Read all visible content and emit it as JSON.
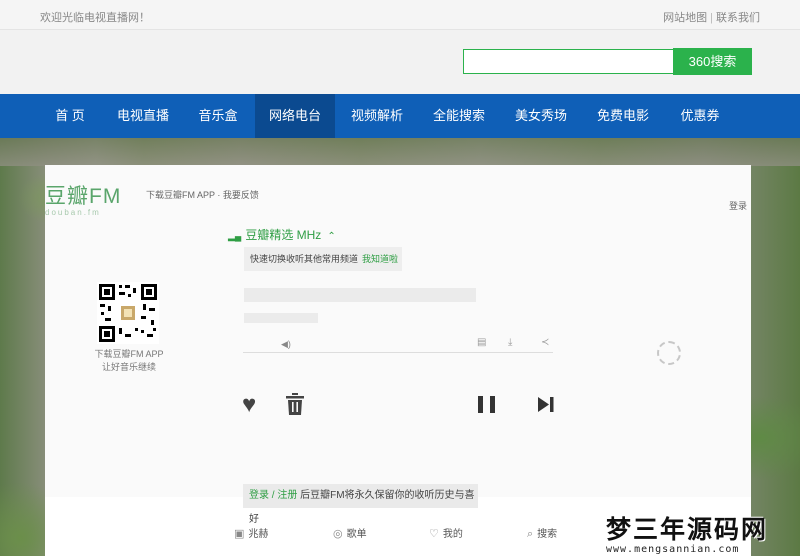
{
  "topbar": {
    "welcome": "欢迎光临电视直播网！",
    "sitemap": "网站地图",
    "separator": "|",
    "contact": "联系我们"
  },
  "search": {
    "placeholder": "",
    "button": "360搜索"
  },
  "nav": {
    "items": [
      {
        "label": "首 页"
      },
      {
        "label": "电视直播"
      },
      {
        "label": "音乐盒"
      },
      {
        "label": "网络电台"
      },
      {
        "label": "视频解析"
      },
      {
        "label": "全能搜索"
      },
      {
        "label": "美女秀场"
      },
      {
        "label": "免费电影"
      },
      {
        "label": "优惠券"
      }
    ],
    "active_index": 3
  },
  "player": {
    "logo_name": "豆瓣FM",
    "logo_sub": "douban.fm",
    "top_links": "下载豆瓣FM APP · 我要反馈",
    "login": "登录",
    "qr_text_1": "下载豆瓣FM APP",
    "qr_text_2": "让好音乐继续",
    "channel": "豆瓣精选 MHz",
    "tip_text": "快速切换收听其他常用频道",
    "tip_got": "我知道啦",
    "login_tip_login": "登录",
    "login_tip_slash": " / ",
    "login_tip_register": "注册",
    "login_tip_rest": " 后豆瓣FM将永久保留你的收听历史与喜好",
    "accent_color": "#2f9e44"
  },
  "bottom_nav": {
    "items": [
      {
        "label": "兆赫",
        "icon": "radio-icon"
      },
      {
        "label": "歌单",
        "icon": "playlist-icon"
      },
      {
        "label": "我的",
        "icon": "heart-icon"
      },
      {
        "label": "搜索",
        "icon": "search-icon"
      }
    ]
  },
  "watermark": {
    "main": "梦三年源码网",
    "sub": "www.mengsannian.com"
  },
  "colors": {
    "nav_bg": "#0f5fb7",
    "nav_active": "#0b4a90",
    "search_button": "#2bb24c"
  }
}
